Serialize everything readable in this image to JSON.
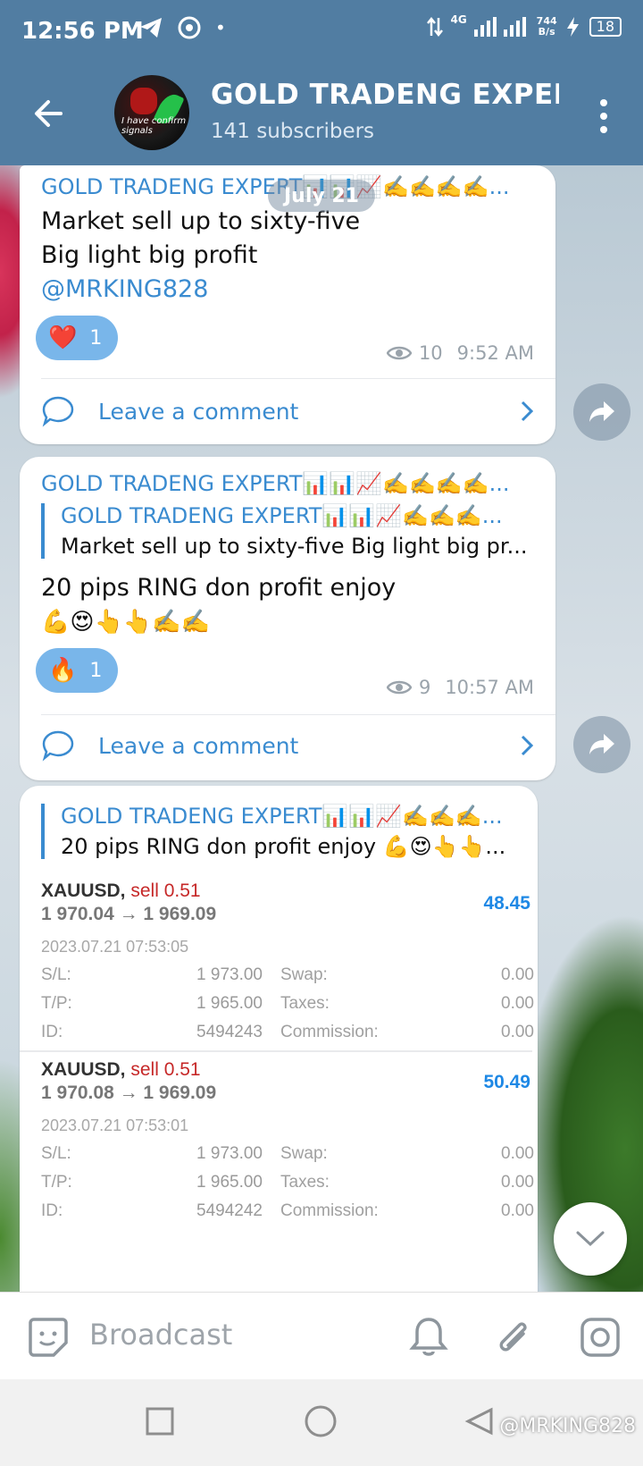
{
  "status_bar": {
    "time": "12:56 PM",
    "network": "4G",
    "speed_value": "744",
    "speed_unit": "B/s",
    "battery": "18"
  },
  "header": {
    "channel_name": "GOLD TRADENG EXPER",
    "subscribers": "141 subscribers",
    "avatar_text": "I have confirm signals"
  },
  "date_pill": "July 21",
  "messages": [
    {
      "sender": "GOLD TRADENG EXPERT📊📊📈✍️✍️✍️✍️...",
      "line1": "Market sell up to sixty-five",
      "line2": "Big light big profit",
      "mention": "@MRKING828",
      "reaction_emoji": "❤️",
      "reaction_count": "1",
      "views": "10",
      "time": "9:52 AM",
      "comment_label": "Leave a comment"
    },
    {
      "sender": "GOLD TRADENG EXPERT📊📊📈✍️✍️✍️✍️...",
      "quote_sender": "GOLD TRADENG EXPERT📊📊📈✍️✍️✍️...",
      "quote_text": "Market sell up to sixty-five Big light big pr...",
      "line1": "20 pips RING don profit enjoy",
      "line2": "💪😍👆👆✍️✍️",
      "reaction_emoji": "🔥",
      "reaction_count": "1",
      "views": "9",
      "time": "10:57 AM",
      "comment_label": "Leave a comment"
    },
    {
      "quote_sender": "GOLD TRADENG EXPERT📊📊📈✍️✍️✍️...",
      "quote_text": "20 pips RING don profit enjoy 💪😍👆👆...",
      "trades": [
        {
          "symbol": "XAUUSD,",
          "side": "sell 0.51",
          "prices": "1 970.04 → 1 969.09",
          "profit": "48.45",
          "datetime": "2023.07.21 07:53:05",
          "sl_label": "S/L:",
          "sl": "1 973.00",
          "tp_label": "T/P:",
          "tp": "1 965.00",
          "id_label": "ID:",
          "id": "5494243",
          "swap_label": "Swap:",
          "swap": "0.00",
          "taxes_label": "Taxes:",
          "taxes": "0.00",
          "commission_label": "Commission:",
          "commission": "0.00"
        },
        {
          "symbol": "XAUUSD,",
          "side": "sell 0.51",
          "prices": "1 970.08 → 1 969.09",
          "profit": "50.49",
          "datetime": "2023.07.21 07:53:01",
          "sl_label": "S/L:",
          "sl": "1 973.00",
          "tp_label": "T/P:",
          "tp": "1 965.00",
          "id_label": "ID:",
          "id": "5494242",
          "swap_label": "Swap:",
          "swap": "0.00",
          "taxes_label": "Taxes:",
          "taxes": "0.00",
          "commission_label": "Commission:",
          "commission": "0.00"
        }
      ]
    }
  ],
  "composer": {
    "placeholder": "Broadcast"
  },
  "watermark": "@MRKING828",
  "icons": [
    "telegram-icon",
    "chrome-icon",
    "back-arrow-icon",
    "kebab-menu-icon",
    "eye-icon",
    "comment-icon",
    "chevron-right-icon",
    "forward-icon",
    "chevron-down-icon",
    "sticker-icon",
    "bell-icon",
    "attach-icon",
    "camera-icon",
    "recent-apps-icon",
    "home-icon",
    "back-nav-icon"
  ]
}
